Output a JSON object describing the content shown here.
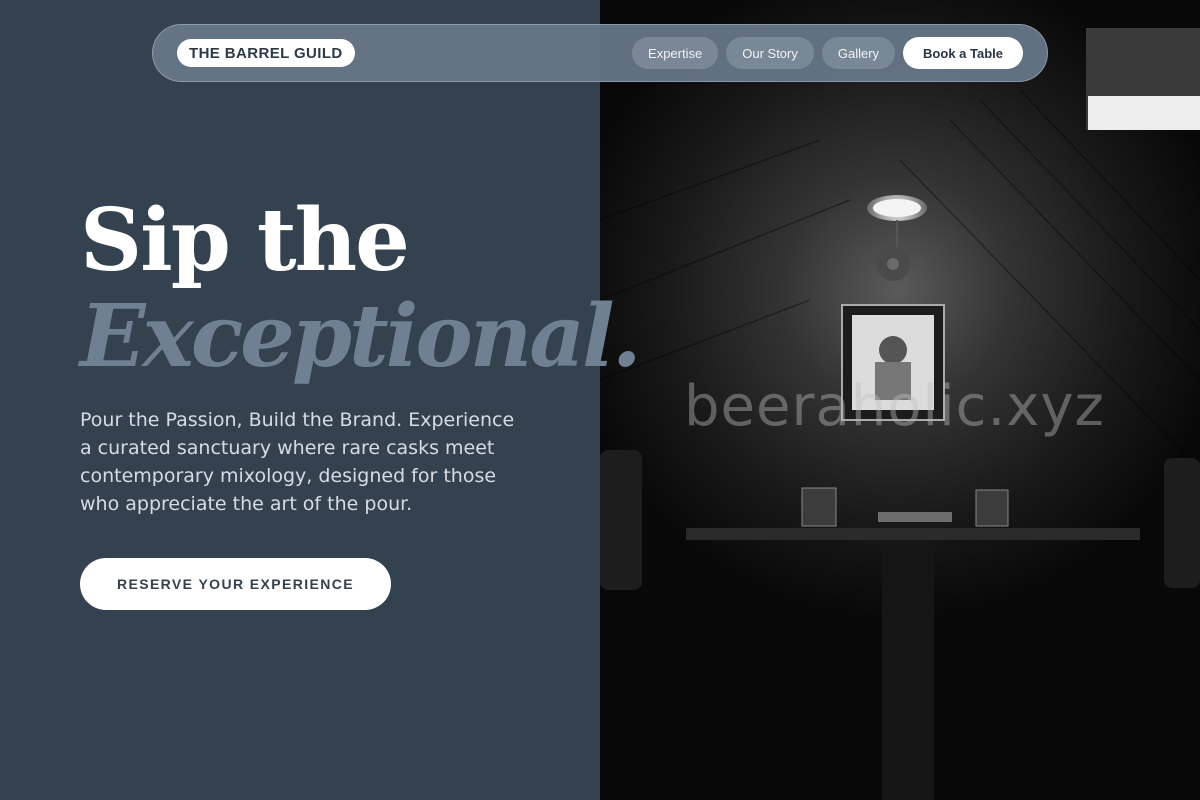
{
  "header": {
    "brand": "THE BARREL GUILD",
    "nav": [
      "Expertise",
      "Our Story",
      "Gallery"
    ],
    "cta": "Book a Table"
  },
  "hero": {
    "headline_line1": "Sip the",
    "headline_line2": "Exceptional.",
    "description": "Pour the Passion, Build the Brand. Experience a curated sanctuary where rare casks meet contemporary mixology, designed for those who appreciate the art of the pour.",
    "button_label": "RESERVE YOUR EXPERIENCE"
  },
  "photo": {
    "watermark": "beeraholic.xyz"
  },
  "colors": {
    "panel": "#344250",
    "accent_text": "#6f8093",
    "body_text": "#d6dce3",
    "button_bg": "#ffffff"
  }
}
